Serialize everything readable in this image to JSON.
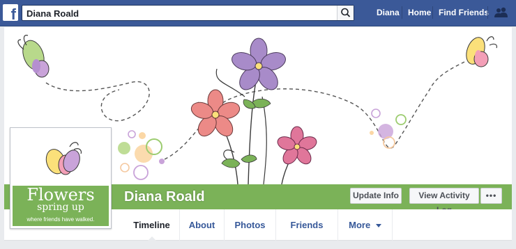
{
  "topbar": {
    "logo": "f",
    "search": {
      "value": "Diana Roald"
    },
    "links": [
      "Diana",
      "Home",
      "Find Friends"
    ]
  },
  "profile": {
    "name": "Diana Roald",
    "picture": {
      "title": "Flowers",
      "subtitle": "spring up",
      "tagline": "where friends have walked."
    },
    "actions": {
      "update_info": "Update Info",
      "activity_log": "View Activity Log",
      "more_dots": "•••"
    }
  },
  "tabs": [
    {
      "label": "Timeline"
    },
    {
      "label": "About"
    },
    {
      "label": "Photos"
    },
    {
      "label": "Friends"
    },
    {
      "label": "More"
    }
  ],
  "colors": {
    "brand": "#3b5998",
    "accent_green": "#7bb258",
    "link": "#365899"
  }
}
